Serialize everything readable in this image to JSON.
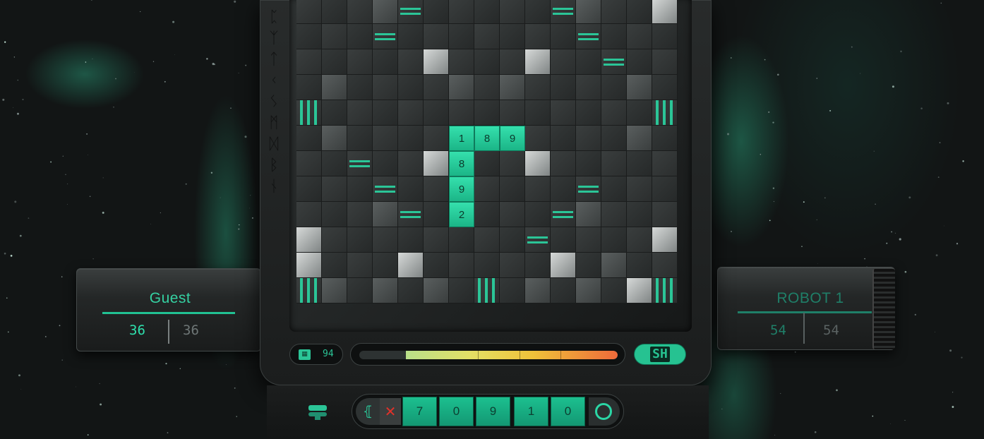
{
  "players": {
    "left": {
      "name": "Guest",
      "score": "36",
      "prev_score": "36"
    },
    "right": {
      "name": "ROBOT 1",
      "score": "54",
      "prev_score": "54"
    }
  },
  "board": {
    "cols": 15,
    "rows": 12,
    "placed_tiles": [
      {
        "row": 5,
        "col": 6,
        "value": "1"
      },
      {
        "row": 5,
        "col": 7,
        "value": "8"
      },
      {
        "row": 5,
        "col": 8,
        "value": "9"
      },
      {
        "row": 6,
        "col": 6,
        "value": "8"
      },
      {
        "row": 7,
        "col": 6,
        "value": "9"
      },
      {
        "row": 8,
        "col": 6,
        "value": "2"
      }
    ]
  },
  "status": {
    "tiles_left": "94",
    "timer_remaining_fraction": 0.82
  },
  "swap_label": "SH",
  "rack": {
    "tiles": [
      "7",
      "0",
      "9",
      "1",
      "0"
    ]
  },
  "icons": {
    "recall": "recall-icon",
    "clear": "clear-x-icon",
    "submit": "submit-circle-icon",
    "chat": "chat-icon",
    "bag": "tile-bag-icon"
  },
  "colors": {
    "accent": "#2bc597",
    "tile": "#22c896",
    "danger": "#e0322a"
  }
}
